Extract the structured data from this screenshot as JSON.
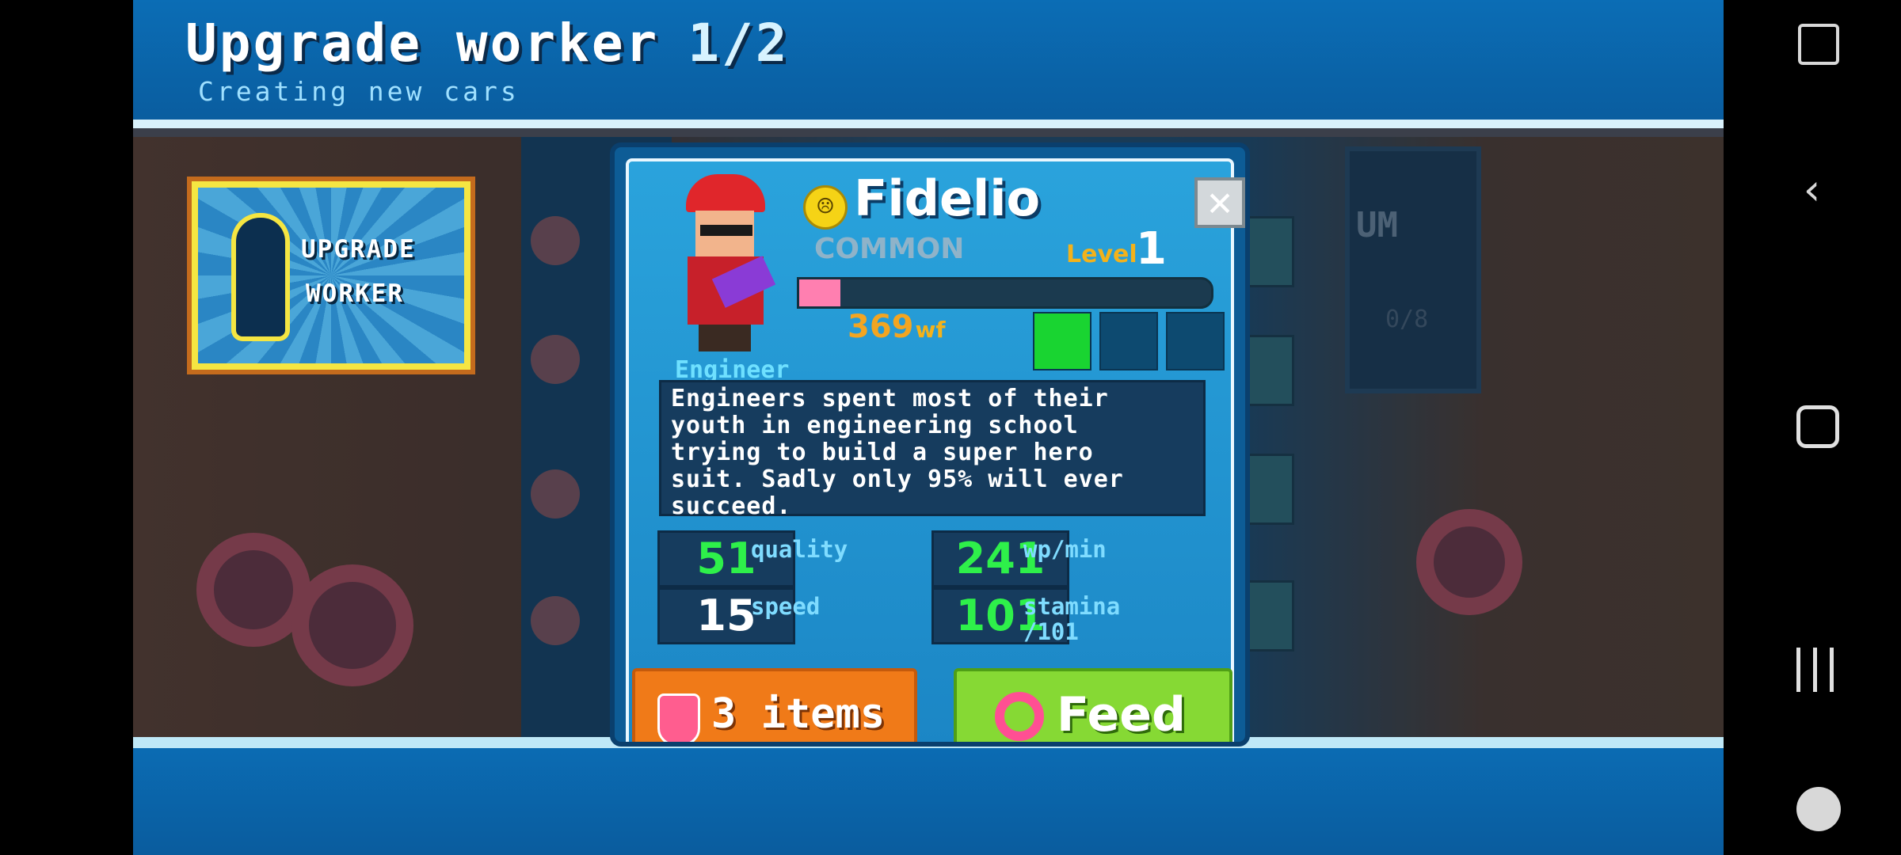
{
  "header": {
    "title": "Upgrade worker",
    "counter": "1/2",
    "subtitle": "Creating new cars"
  },
  "upgrade_card": {
    "line1": "UPGRADE",
    "line2": "WORKER"
  },
  "background": {
    "upgrade_box_text": "UM",
    "upgrade_box_count": "0/8"
  },
  "worker": {
    "mood_icon": "sad-face-icon",
    "name": "Fidelio",
    "rarity": "COMMON",
    "level_label": "Level",
    "level": "1",
    "xp_fraction": 0.1,
    "wf_value": "369",
    "wf_unit": "wf",
    "slots_active": 1,
    "slots_total": 3,
    "role": "Engineer",
    "description": "Engineers spent most of their\nyouth in engineering school\ntrying to build a super hero\nsuit. Sadly only 95% will ever\nsucceed."
  },
  "stats": {
    "quality_value": "51",
    "quality_label": "quality",
    "wp_value": "241",
    "wp_label": "wp/min",
    "speed_value": "15",
    "speed_label": "speed",
    "stamina_value": "101",
    "stamina_label": "stamina\n/101"
  },
  "buttons": {
    "items_label": "3 items",
    "feed_label": "Feed"
  },
  "colors": {
    "header_blue": "#0b6db5",
    "stat_green": "#2ef04a",
    "items_orange": "#f07a18",
    "feed_green": "#86d934",
    "level_gold": "#f3b21b"
  }
}
